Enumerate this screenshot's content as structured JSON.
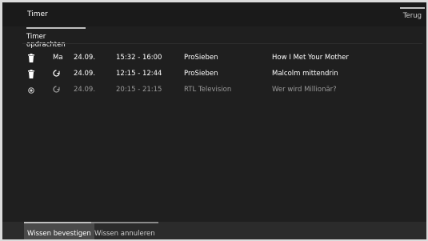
{
  "header": {
    "title": "Timer",
    "back_label": "Terug"
  },
  "section": {
    "tab_label": "Timer opdrachten"
  },
  "rows": [
    {
      "status_icon": "trash-icon",
      "secondary": "Ma",
      "date": "24.09.",
      "time": "15:32 - 16:00",
      "channel": "ProSieben",
      "title": "How I Met Your Mother"
    },
    {
      "status_icon": "trash-icon",
      "secondary_icon": "repeat-icon",
      "date": "24.09.",
      "time": "12:15 - 12:44",
      "channel": "ProSieben",
      "title": "Malcolm mittendrin"
    },
    {
      "status_icon": "record-icon",
      "secondary_icon": "repeat-icon",
      "date": "24.09.",
      "time": "20:15 - 21:15",
      "channel": "RTL Television",
      "title": "Wer wird Millionär?"
    }
  ],
  "footer": {
    "confirm_label": "Wissen bevestigen",
    "cancel_label": "Wissen annuleren"
  },
  "colors": {
    "background": "#1f1f1f",
    "text": "#ffffff",
    "dim_text": "#9a9a9a",
    "footer_bg": "#2b2b2b"
  }
}
